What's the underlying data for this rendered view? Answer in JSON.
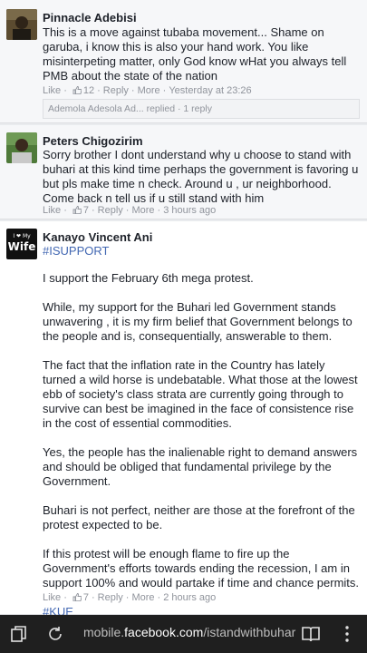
{
  "comments": [
    {
      "author": "Pinnacle Adebisi",
      "text": "This is a move against tubaba movement... Shame on garuba, i know this is also your hand work. You like misinterpeting matter, only God know wHat you always tell PMB about the state of the nation",
      "like_label": "Like",
      "like_count": "12",
      "reply_label": "Reply",
      "more_label": "More",
      "time": "Yesterday at 23:26",
      "replies_summary": "Ademola Adesola Ad... replied · 1 reply"
    },
    {
      "author": "Peters Chigozirim",
      "text": "Sorry brother I dont understand why u choose to stand with buhari at this kind time perhaps the government is favoring u but pls make time n check. Around u , ur neighborhood. Come back n tell us if u still stand with him",
      "like_label": "Like",
      "like_count": "7",
      "reply_label": "Reply",
      "more_label": "More",
      "time": "3 hours ago"
    },
    {
      "author": "Kanayo Vincent Ani",
      "avatar_text_top": "I ❤ My",
      "avatar_text_main": "Wife",
      "hashtag_top": "#ISUPPORT",
      "paragraphs": [
        "I support the February 6th mega protest.",
        "While, my support for the Buhari led Government stands unwavering , it is my firm belief that Government belongs to the people and is, consequentially, answerable to them.",
        "The fact that the inflation rate in the Country has lately turned a wild horse is undebatable. What those at the lowest ebb of society's class strata are currently going through to survive can best be imagined in the face of consistence rise in the cost of essential commodities.",
        "Yes, the people has the inalienable right to demand answers and should be obliged that fundamental privilege by the Government.",
        "Buhari is not perfect, neither are those at the forefront of the protest expected to be.",
        "If this protest will be enough flame to fire up the Government's efforts towards ending the recession, I am in support 100% and would partake if time and chance permits."
      ],
      "hashtag_bottom": "#KUE",
      "like_label": "Like",
      "like_count": "7",
      "reply_label": "Reply",
      "more_label": "More",
      "time": "2 hours ago"
    }
  ],
  "browser": {
    "url_prefix": "mobile.",
    "url_domain": "facebook.com",
    "url_path": "/istandwithbuhar"
  }
}
